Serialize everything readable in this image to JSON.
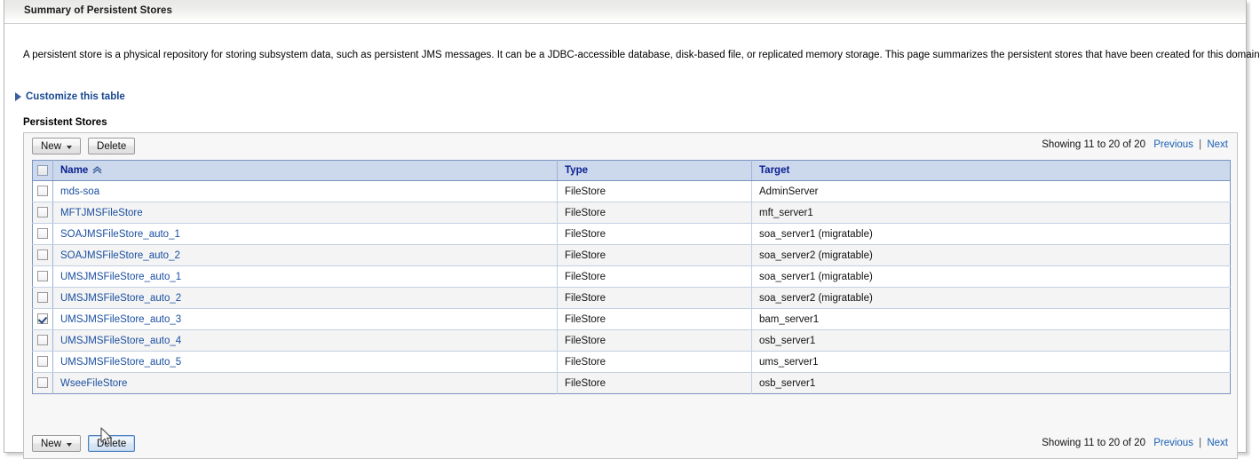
{
  "window": {
    "title": "Summary of Persistent Stores"
  },
  "intro": {
    "text": "A persistent store is a physical repository for storing subsystem data, such as persistent JMS messages. It can be a JDBC-accessible database, disk-based file, or replicated memory storage. This page summarizes the persistent stores that have been created for this domain."
  },
  "customize": {
    "label": "Customize this table",
    "icon": "disclosure-arrow-right-icon"
  },
  "section": {
    "heading": "Persistent Stores"
  },
  "toolbar": {
    "new_label": "New",
    "delete_label": "Delete"
  },
  "paging": {
    "count_text": "Showing 11 to 20 of 20",
    "previous_label": "Previous",
    "separator": "|",
    "next_label": "Next"
  },
  "table": {
    "columns": [
      {
        "key": "name",
        "label": "Name",
        "sort": "ascending"
      },
      {
        "key": "type",
        "label": "Type",
        "sort": "none"
      },
      {
        "key": "target",
        "label": "Target",
        "sort": "none"
      }
    ],
    "rows": [
      {
        "selected": false,
        "name": "mds-soa",
        "type": "FileStore",
        "target": "AdminServer"
      },
      {
        "selected": false,
        "name": "MFTJMSFileStore",
        "type": "FileStore",
        "target": "mft_server1"
      },
      {
        "selected": false,
        "name": "SOAJMSFileStore_auto_1",
        "type": "FileStore",
        "target": "soa_server1 (migratable)"
      },
      {
        "selected": false,
        "name": "SOAJMSFileStore_auto_2",
        "type": "FileStore",
        "target": "soa_server2 (migratable)"
      },
      {
        "selected": false,
        "name": "UMSJMSFileStore_auto_1",
        "type": "FileStore",
        "target": "soa_server1 (migratable)"
      },
      {
        "selected": false,
        "name": "UMSJMSFileStore_auto_2",
        "type": "FileStore",
        "target": "soa_server2 (migratable)"
      },
      {
        "selected": true,
        "name": "UMSJMSFileStore_auto_3",
        "type": "FileStore",
        "target": "bam_server1"
      },
      {
        "selected": false,
        "name": "UMSJMSFileStore_auto_4",
        "type": "FileStore",
        "target": "osb_server1"
      },
      {
        "selected": false,
        "name": "UMSJMSFileStore_auto_5",
        "type": "FileStore",
        "target": "ums_server1"
      },
      {
        "selected": false,
        "name": "WseeFileStore",
        "type": "FileStore",
        "target": "osb_server1"
      }
    ]
  },
  "colors": {
    "header_bg": "#ccd8ec",
    "header_text": "#0a1f8f",
    "link": "#1a4fa0",
    "accent_link": "#18488f",
    "table_border": "#7b94c0",
    "row_alt_bg": "#f4f4f4",
    "panel_bg": "#f7f7f7"
  }
}
